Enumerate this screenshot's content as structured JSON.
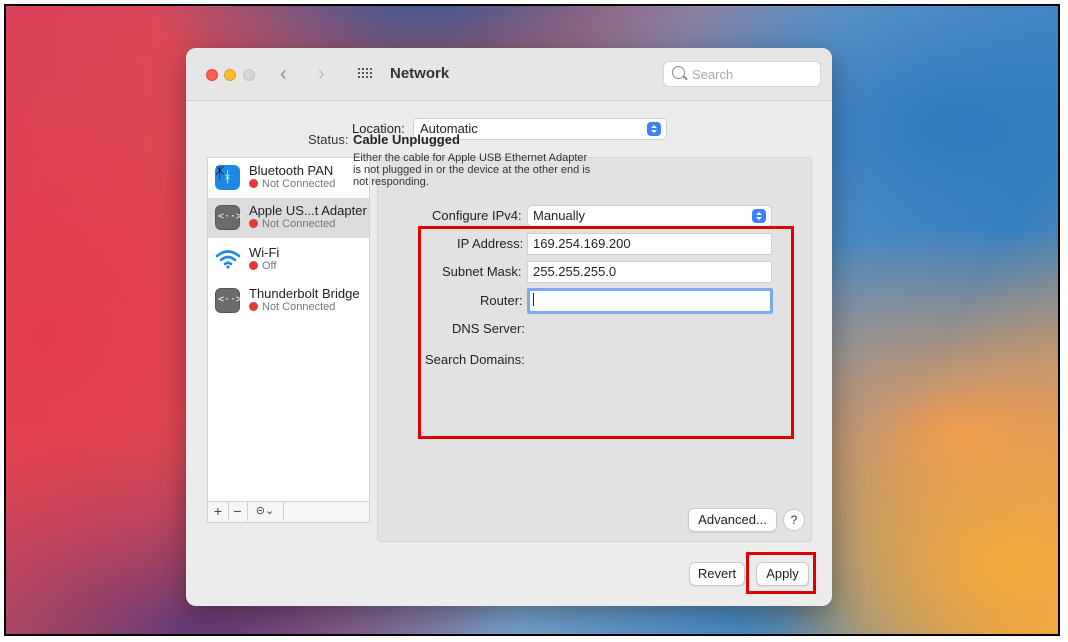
{
  "window": {
    "title": "Network"
  },
  "search": {
    "placeholder": "Search"
  },
  "location": {
    "label": "Location:",
    "value": "Automatic"
  },
  "sidebar": {
    "items": [
      {
        "name": "Bluetooth PAN",
        "status": "Not Connected",
        "icon": "bluetooth-icon"
      },
      {
        "name": "Apple US...t Adapter",
        "status": "Not Connected",
        "icon": "ethernet-icon"
      },
      {
        "name": "Wi-Fi",
        "status": "Off",
        "icon": "wifi-icon"
      },
      {
        "name": "Thunderbolt Bridge",
        "status": "Not Connected",
        "icon": "ethernet-icon"
      }
    ],
    "add_label": "+",
    "remove_label": "−",
    "more_label": "⊝⌄"
  },
  "status": {
    "label": "Status:",
    "value": "Cable Unplugged",
    "description": "Either the cable for Apple USB Ethernet Adapter is not plugged in or the device at the other end is not responding."
  },
  "config": {
    "configure_ipv4_label": "Configure IPv4:",
    "configure_ipv4_value": "Manually",
    "ip_label": "IP Address:",
    "ip_value": "169.254.169.200",
    "subnet_label": "Subnet Mask:",
    "subnet_value": "255.255.255.0",
    "router_label": "Router:",
    "router_value": "",
    "dns_label": "DNS Server:",
    "search_domains_label": "Search Domains:"
  },
  "buttons": {
    "advanced": "Advanced...",
    "help": "?",
    "revert": "Revert",
    "apply": "Apply"
  },
  "colors": {
    "highlight": "#e00000",
    "stepper": "#3b82f6",
    "status_dot": "#e53935"
  }
}
